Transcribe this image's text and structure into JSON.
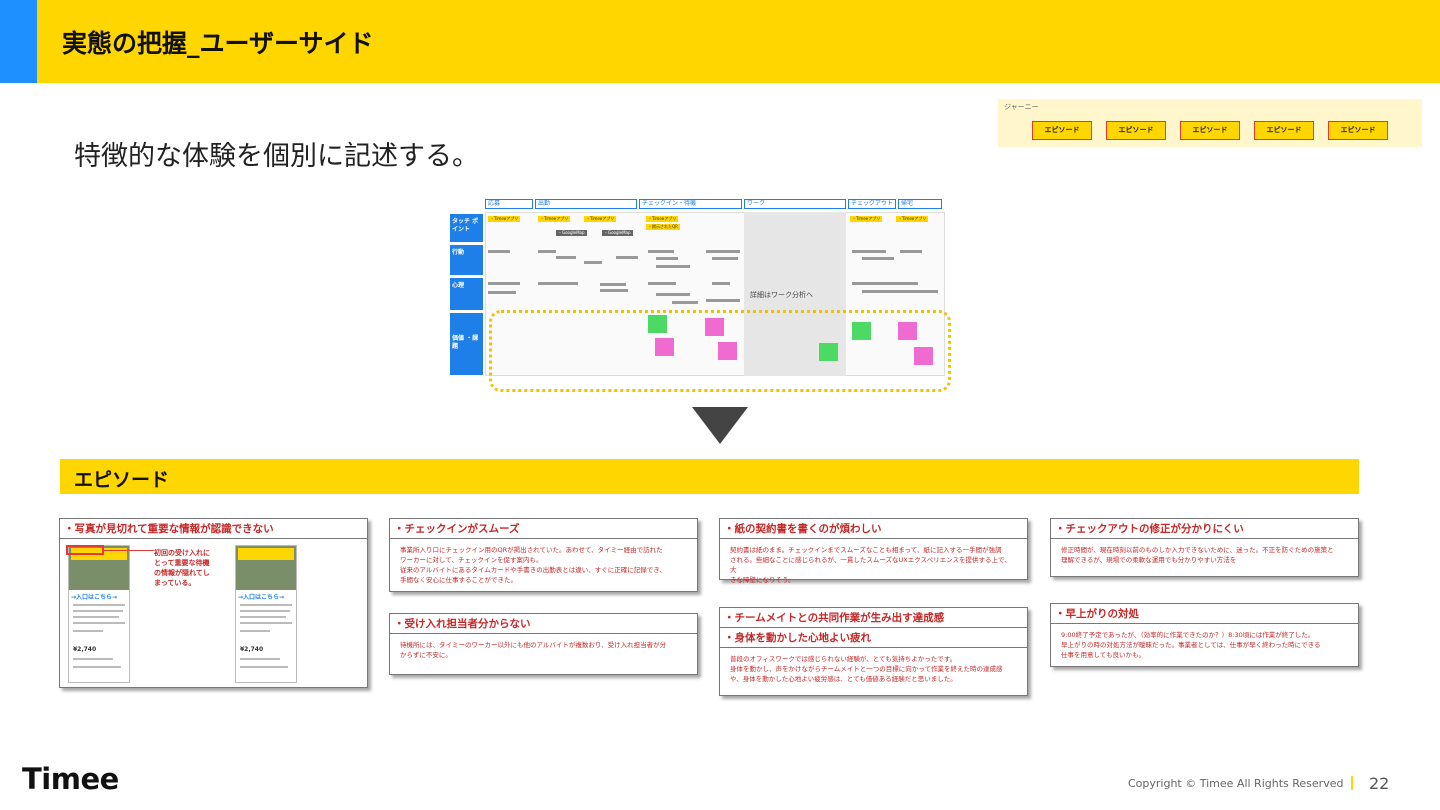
{
  "header": {
    "title": "実態の把握_ユーザーサイド",
    "accent_color": "#1E90FF",
    "background_color": "#FFD600"
  },
  "subtitle": "特徴的な体験を個別に記述する。",
  "journey": {
    "label": "ジャーニー",
    "episodes": [
      "エピソード",
      "エピソード",
      "エピソード",
      "エピソード",
      "エピソード"
    ]
  },
  "journey_map": {
    "phases": [
      "応募",
      "出勤",
      "チェックイン・待機",
      "ワーク",
      "チェックアウト",
      "帰宅"
    ],
    "rows": [
      "タッチ ポイント",
      "行動",
      "心理",
      "価値 ・課題"
    ],
    "work_note": "詳細はワーク分析へ",
    "touchpoints": [
      "・Timeeアプリ",
      "・Timeeアプリ",
      "・Timeeアプリ",
      "・Timeeアプリ",
      "・Timeeアプリ",
      "・Timeeアプリ",
      "・掲示されたQR",
      "・GoogleMap",
      "・GoogleMap"
    ]
  },
  "section": {
    "title": "エピソード"
  },
  "cards": {
    "photo": {
      "title": "・写真が見切れて重要な情報が認識できない",
      "annotation": [
        "初回の受け入れに",
        "とって重要な待機",
        "の情報が隠れてし",
        "まっている。"
      ],
      "phone_enter": "→入口はこちら→",
      "phone_price": "¥2,740"
    },
    "checkin": {
      "title": "・チェックインがスムーズ",
      "body": [
        "事業所入り口にチェックイン用のQRが掲出されていた。あわせて、タイミー経由で訪れた",
        "ワーカーに対して、チェックインを促す案内も。",
        "従来のアルバイトにあるタイムカードや手書きの出勤表とは違い、すぐに正確に記録でき、",
        "手間なく安心に仕事することができた。"
      ]
    },
    "contact": {
      "title": "・受け入れ担当者分からない",
      "body": [
        "待機所には、タイミーのワーカー以外にも他のアルバイトが複数おり、受け入れ担当者が分",
        "からずに不安に。"
      ]
    },
    "paper": {
      "title": "・紙の契約書を書くのが煩わしい",
      "body": [
        "契約書は紙のまま。チェックインまでスムーズなことも相まって、紙に記入する一手間が強調",
        "される。些細なことに感じられるが、一貫したスムーズなUXエクスペリエンスを提供する上で、大",
        "きな障壁になりそう。"
      ]
    },
    "team": {
      "title": "・チームメイトとの共同作業が生み出す達成感",
      "title2": "・身体を動かした心地よい疲れ",
      "body": [
        "普段のオフィスワークでは感じられない経験が、とても気持ちよかったです。",
        "身体を動かし、声をかけながらチームメイトと一つの目標に向かって作業を終えた時の達成感",
        "や、身体を動かした心地よい疲労感は、とても価値ある経験だと思いました。"
      ]
    },
    "checkout": {
      "title": "・チェックアウトの修正が分かりにくい",
      "body": [
        "修正時間が、現在時刻以前のものしか入力できないために、迷った。不正を防ぐための施策と",
        "理解できるが、現場での柔軟な運用でも分かりやすい方法を"
      ]
    },
    "early": {
      "title": "・早上がりの対処",
      "body": [
        "9:00終了予定であったが、（効率的に作業できたのか？）8:30頃には作業が終了した。",
        "早上がりの時の対処方法が曖昧だった。事業者としては、仕事が早く終わった時にできる",
        "仕事を用意しても良いかも。"
      ]
    }
  },
  "footer": {
    "logo": "Timee",
    "copyright": "Copyright © Timee All Rights Reserved",
    "page": "22"
  }
}
